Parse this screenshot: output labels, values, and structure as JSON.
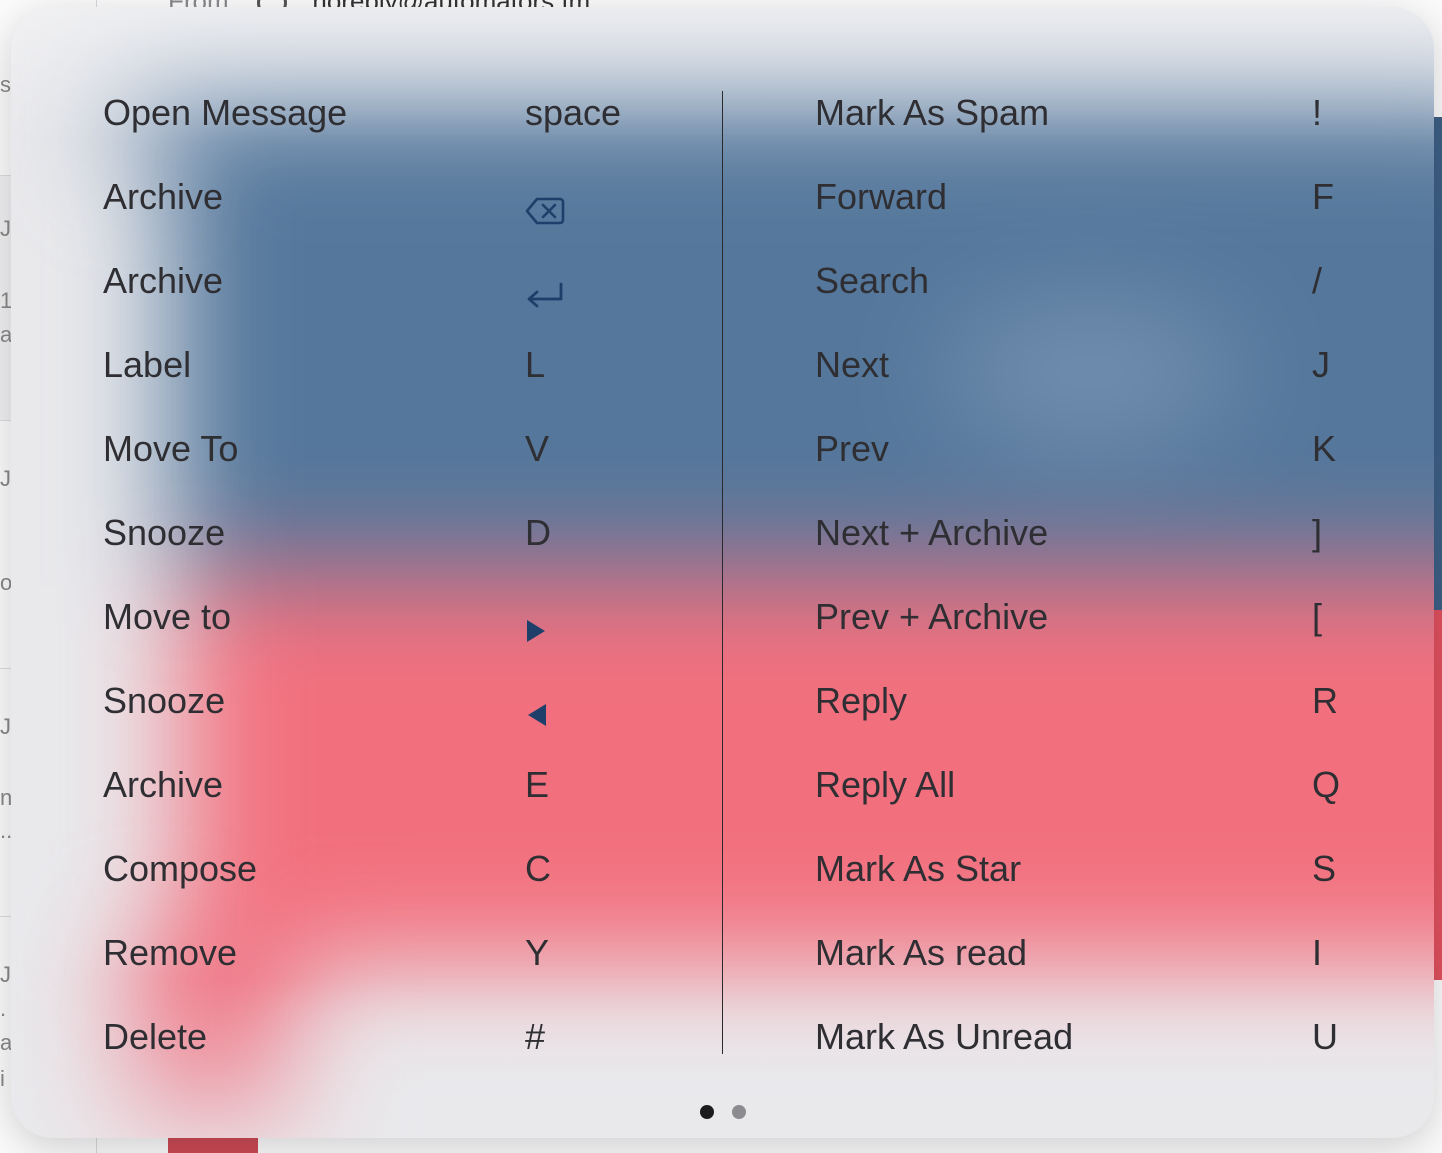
{
  "background": {
    "from_label": "From:",
    "from_address": "noreply@automators.fm",
    "left_fragments": [
      "s.",
      "J",
      "1",
      "a.",
      "J",
      "o.",
      "J",
      "n",
      "..",
      "J",
      ".",
      "at",
      "i"
    ]
  },
  "shortcuts": {
    "left": [
      {
        "action": "Open Message",
        "key": "space",
        "icon": null
      },
      {
        "action": "Archive",
        "key": "",
        "icon": "delete-backward-icon"
      },
      {
        "action": "Archive",
        "key": "",
        "icon": "return-icon"
      },
      {
        "action": "Label",
        "key": "L",
        "icon": null
      },
      {
        "action": "Move To",
        "key": "V",
        "icon": null
      },
      {
        "action": "Snooze",
        "key": "D",
        "icon": null
      },
      {
        "action": "Move to",
        "key": "",
        "icon": "right-arrow-icon"
      },
      {
        "action": "Snooze",
        "key": "",
        "icon": "left-arrow-icon"
      },
      {
        "action": "Archive",
        "key": "E",
        "icon": null
      },
      {
        "action": "Compose",
        "key": "C",
        "icon": null
      },
      {
        "action": "Remove",
        "key": "Y",
        "icon": null
      },
      {
        "action": "Delete",
        "key": "#",
        "icon": null
      }
    ],
    "right": [
      {
        "action": "Mark As Spam",
        "key": "!"
      },
      {
        "action": "Forward",
        "key": "F"
      },
      {
        "action": "Search",
        "key": "/"
      },
      {
        "action": "Next",
        "key": "J"
      },
      {
        "action": "Prev",
        "key": "K"
      },
      {
        "action": "Next + Archive",
        "key": "]"
      },
      {
        "action": "Prev + Archive",
        "key": "["
      },
      {
        "action": "Reply",
        "key": "R"
      },
      {
        "action": "Reply All",
        "key": "Q"
      },
      {
        "action": "Mark As Star",
        "key": "S"
      },
      {
        "action": "Mark As read",
        "key": "I"
      },
      {
        "action": "Mark As Unread",
        "key": "U"
      }
    ]
  },
  "pagination": {
    "pages": 2,
    "current": 1
  },
  "colors": {
    "icon_color": "#1f3f6b",
    "text_color": "#2e2e33",
    "blur_blue": "#54779b",
    "blur_red": "#f2707e"
  }
}
